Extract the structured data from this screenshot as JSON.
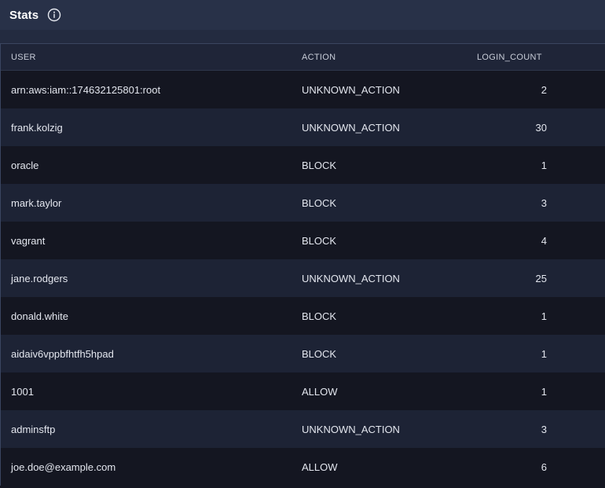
{
  "panel": {
    "title": "Stats",
    "info_icon": "info-icon"
  },
  "table": {
    "columns": [
      "USER",
      "ACTION",
      "LOGIN_COUNT"
    ],
    "rows": [
      {
        "user": "arn:aws:iam::174632125801:root",
        "action": "UNKNOWN_ACTION",
        "login_count": "2"
      },
      {
        "user": "frank.kolzig",
        "action": "UNKNOWN_ACTION",
        "login_count": "30"
      },
      {
        "user": "oracle",
        "action": "BLOCK",
        "login_count": "1"
      },
      {
        "user": "mark.taylor",
        "action": "BLOCK",
        "login_count": "3"
      },
      {
        "user": "vagrant",
        "action": "BLOCK",
        "login_count": "4"
      },
      {
        "user": "jane.rodgers",
        "action": "UNKNOWN_ACTION",
        "login_count": "25"
      },
      {
        "user": "donald.white",
        "action": "BLOCK",
        "login_count": "1"
      },
      {
        "user": "aidaiv6vppbfhtfh5hpad",
        "action": "BLOCK",
        "login_count": "1"
      },
      {
        "user": "1001",
        "action": "ALLOW",
        "login_count": "1"
      },
      {
        "user": "adminsftp",
        "action": "UNKNOWN_ACTION",
        "login_count": "3"
      },
      {
        "user": "joe.doe@example.com",
        "action": "ALLOW",
        "login_count": "6"
      }
    ]
  },
  "colors": {
    "header_bg": "#283148",
    "row_odd": "#141621",
    "row_even": "#1d2335",
    "text": "#e3e6ee"
  }
}
